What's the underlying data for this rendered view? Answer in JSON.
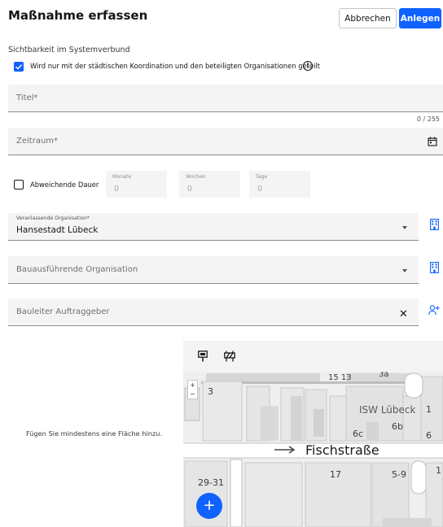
{
  "header": {
    "title": "Maßnahme erfassen",
    "cancel_label": "Abbrechen",
    "create_label": "Anlegen"
  },
  "visibility": {
    "label": "Sichtbarkeit im Systemverbund",
    "checkbox_text": "Wird nur mit der städtischen Koordination und den beteiligten Organisationen geteilt",
    "checked": true
  },
  "form": {
    "title_placeholder": "Titel*",
    "title_counter": "0 / 255",
    "period_placeholder": "Zeitraum*",
    "duration": {
      "checkbox_label": "Abweichende Dauer",
      "months_label": "Monate",
      "months_value": "0",
      "weeks_label": "Wochen",
      "weeks_value": "0",
      "days_label": "Tage",
      "days_value": "0"
    },
    "initiating_org_label": "Veranlassende Organisation*",
    "initiating_org_value": "Hansestadt Lübeck",
    "executing_org_placeholder": "Bauausführende Organisation",
    "site_manager_placeholder": "Bauleiter Auftraggeber"
  },
  "map": {
    "empty_hint": "Fügen Sie mindestens eine Fläche hinzu.",
    "zoom_in": "+",
    "zoom_out": "−",
    "labels": {
      "n1513": "15 13",
      "n3a": "3a",
      "n3": "3",
      "isw": "ISW Lübeck",
      "n1": "1",
      "n6b": "6b",
      "n6c": "6c",
      "n6": "6",
      "street": "Fischstraße",
      "n17": "17",
      "n59": "5-9",
      "n1b": "1",
      "n2931": "29-31"
    },
    "fab_label": "+"
  }
}
